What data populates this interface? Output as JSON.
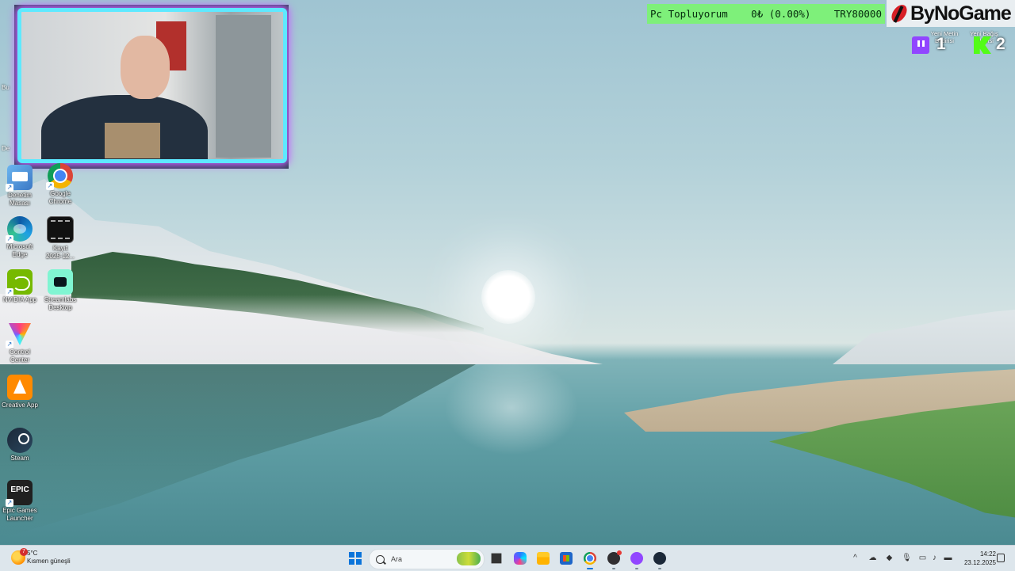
{
  "overlay": {
    "donation": {
      "title": "Pc Topluyorum",
      "progress": "0₺ (0.00%)",
      "goal": "TRY80000"
    },
    "brand": "ByNoGame",
    "goals": [
      {
        "label_line1": "Yeni Metin",
        "label_line2": "Bildirisi",
        "platform": "twitch-icon",
        "count": "1"
      },
      {
        "label_line1": "Yeni Bağış",
        "label_line2": "Bildirisi",
        "platform": "kick-icon",
        "count": "2"
      }
    ]
  },
  "desktop": {
    "partial_labels": [
      "Bu",
      "De"
    ],
    "icons": [
      {
        "name": "Denetim Masası",
        "line1": "Denetim",
        "line2": "Masası",
        "icon": "control-panel-icon"
      },
      {
        "name": "Google Chrome",
        "line1": "Google",
        "line2": "Chrome",
        "icon": "chrome-icon"
      },
      {
        "name": "Microsoft Edge",
        "line1": "Microsoft",
        "line2": "Edge",
        "icon": "edge-icon"
      },
      {
        "name": "Kayıt 2025-12...",
        "line1": "Kayıt",
        "line2": "2025-12...",
        "icon": "video-file-icon"
      },
      {
        "name": "NVIDIA App",
        "line1": "NVIDIA App",
        "line2": "",
        "icon": "nvidia-icon"
      },
      {
        "name": "Streamlabs Desktop",
        "line1": "Streamlabs",
        "line2": "Desktop",
        "icon": "streamlabs-icon"
      },
      {
        "name": "Control Center",
        "line1": "Control",
        "line2": "Center",
        "icon": "control-center-icon"
      },
      {
        "name": "Creative App",
        "line1": "Creative App",
        "line2": "",
        "icon": "creative-app-icon"
      },
      {
        "name": "Steam",
        "line1": "Steam",
        "line2": "",
        "icon": "steam-icon"
      },
      {
        "name": "Epic Games Launcher",
        "line1": "Epic Games",
        "line2": "Launcher",
        "icon": "epic-games-icon"
      }
    ]
  },
  "taskbar": {
    "weather": {
      "temp": "5°C",
      "condition": "Kısmen güneşli",
      "badge": "7"
    },
    "search_placeholder": "Ara",
    "apps": [
      "start-icon",
      "task-view-icon",
      "copilot-icon",
      "file-explorer-icon",
      "store-icon",
      "chrome-icon",
      "obs-icon",
      "twitch-icon",
      "steam-icon"
    ],
    "tray": {
      "chevron": "^",
      "time": "14:22",
      "date": "23.12.2025"
    }
  },
  "colors": {
    "donation_bg": "#7ef07a",
    "cam_border": "#5ee9ff",
    "cam_glow": "#c560ff",
    "taskbar_bg": "#dde6ec",
    "accent": "#0a74da"
  }
}
